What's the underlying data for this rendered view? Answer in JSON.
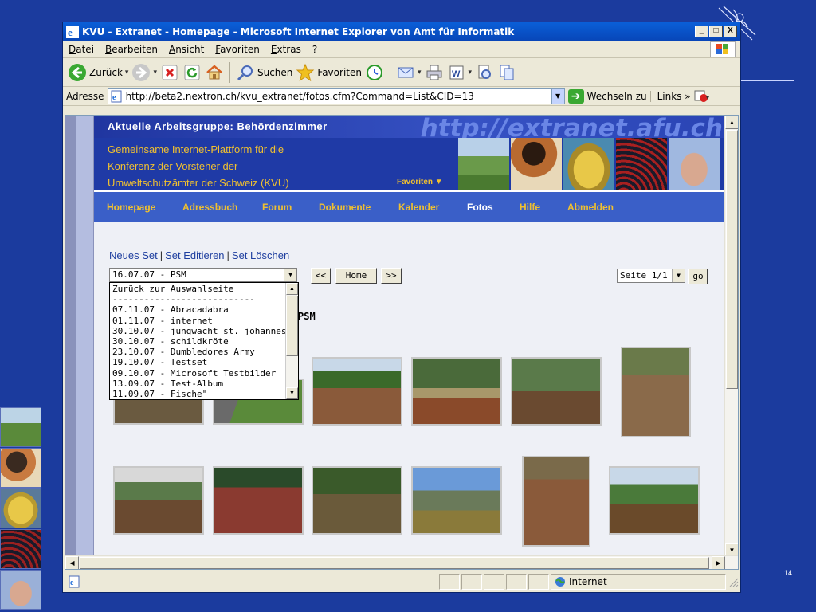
{
  "window": {
    "title": "KVU - Extranet - Homepage - Microsoft Internet Explorer von Amt für Informatik",
    "buttons": [
      "_",
      "□",
      "X"
    ]
  },
  "menu": [
    "Datei",
    "Bearbeiten",
    "Ansicht",
    "Favoriten",
    "Extras",
    "?"
  ],
  "toolbar": {
    "back_label": "Zurück",
    "search_label": "Suchen",
    "favorites_label": "Favoriten"
  },
  "address": {
    "label": "Adresse",
    "url": "http://beta2.nextron.ch/kvu_extranet/fotos.cfm?Command=List&CID=13",
    "go_label": "Wechseln zu",
    "links_label": "Links"
  },
  "site": {
    "group_title": "Aktuelle Arbeitsgruppe: Behördenzimmer",
    "url_banner": "http://extranet.afu.ch",
    "description": [
      "Gemeinsame Internet-Plattform für die",
      "Konferenz der Vorsteher der",
      "Umweltschutzämter der Schweiz (KVU)"
    ],
    "favorites_label": "Favoriten ▼",
    "nav": [
      "Homepage",
      "Adressbuch",
      "Forum",
      "Dokumente",
      "Kalender",
      "Fotos",
      "Hilfe",
      "Abmelden"
    ],
    "active_nav": "Fotos"
  },
  "photos": {
    "links": [
      "Neues Set",
      "Set Editieren",
      "Set Löschen"
    ],
    "link_separator": "|",
    "selected_set": "16.07.07 - PSM",
    "prev_label": "<<",
    "home_label": "Home",
    "next_label": ">>",
    "page_select": "Seite 1/1",
    "go_label": "go",
    "set_title": "PSM",
    "dropdown_options": [
      "Zurück zur Auswahlseite",
      "---------------------------",
      "07.11.07 - Abracadabra",
      "01.11.07 - internet",
      "30.10.07 - jungwacht st. johannes",
      "30.10.07 - schildkröte",
      "23.10.07 - Dumbledores Army",
      "19.10.07 - Testset",
      "09.10.07 - Microsoft Testbilder",
      "13.09.07 - Test-Album",
      "11.09.07 - Fische\""
    ]
  },
  "status": {
    "zone": "Internet"
  },
  "slide": {
    "page_number": "14"
  },
  "colors": {
    "slide_bg": "#1b3b9e",
    "title_bar": "#0a5fd8",
    "site_header": "#1f3aa6",
    "nav_bg": "#3a5fc8",
    "nav_text": "#f0c030",
    "link_color": "#2040a0"
  }
}
